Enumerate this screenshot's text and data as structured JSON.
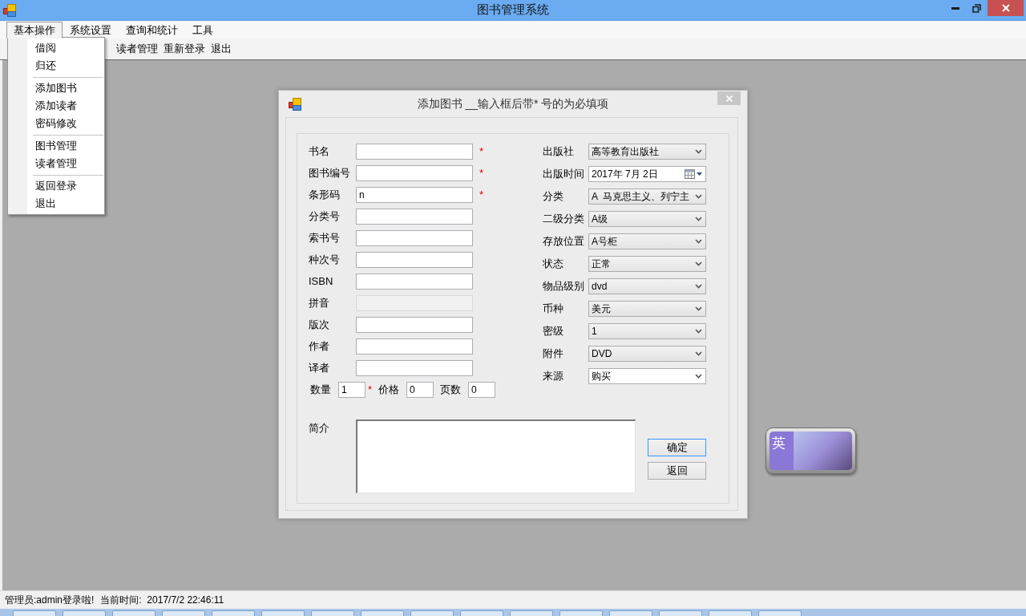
{
  "window": {
    "title": "图书管理系统"
  },
  "menubar": {
    "items": [
      {
        "label": "基本操作",
        "selected": true
      },
      {
        "label": "系统设置",
        "selected": false
      },
      {
        "label": "查询和统计",
        "selected": false
      },
      {
        "label": "工具",
        "selected": false
      }
    ]
  },
  "menu_dropdown": {
    "groups": [
      {
        "items": [
          "借阅",
          "归还"
        ]
      },
      {
        "items": [
          "添加图书",
          "添加读者",
          "密码修改"
        ]
      },
      {
        "items": [
          "图书管理",
          "读者管理"
        ]
      },
      {
        "items": [
          "返回登录",
          "退出"
        ]
      }
    ]
  },
  "toolbar": {
    "items": [
      "读者管理",
      "重新登录",
      "退出"
    ]
  },
  "dialog": {
    "title": "添加图书 __输入框后带* 号的为必填项",
    "left_fields": [
      {
        "label": "书名",
        "mark": "*",
        "disabled": false
      },
      {
        "label": "图书编号",
        "mark": "*",
        "disabled": false
      },
      {
        "label": "条形码",
        "value": "n",
        "mark": "*",
        "disabled": false
      },
      {
        "label": "分类号",
        "disabled": false
      },
      {
        "label": "索书号",
        "disabled": false
      },
      {
        "label": "种次号",
        "disabled": false
      },
      {
        "label": "ISBN",
        "disabled": false
      },
      {
        "label": "拼音",
        "disabled": true
      },
      {
        "label": "版次",
        "disabled": false
      },
      {
        "label": "作者",
        "disabled": false
      },
      {
        "label": "译者",
        "disabled": false
      }
    ],
    "count_row": [
      {
        "label": "数量",
        "value": "1",
        "mark": "*"
      },
      {
        "label": "价格",
        "value": "0"
      },
      {
        "label": "页数",
        "value": "0"
      }
    ],
    "right_fields": [
      {
        "label": "出版社",
        "kind": "select",
        "value": "高等教育出版社"
      },
      {
        "label": "出版时间",
        "kind": "date",
        "value": "2017年 7月 2日"
      },
      {
        "label": "分类",
        "kind": "select",
        "value": "A  马克思主义、列宁主"
      },
      {
        "label": "二级分类",
        "kind": "select",
        "value": "A级"
      },
      {
        "label": "存放位置",
        "kind": "select",
        "value": "A号柜"
      },
      {
        "label": "状态",
        "kind": "select",
        "value": "正常"
      },
      {
        "label": "物品级别",
        "kind": "select",
        "value": "dvd"
      },
      {
        "label": "币种",
        "kind": "select",
        "value": "美元"
      },
      {
        "label": "密级",
        "kind": "select",
        "value": "1"
      },
      {
        "label": "附件",
        "kind": "select",
        "value": "DVD"
      },
      {
        "label": "来源",
        "kind": "combo",
        "value": "购买"
      }
    ],
    "description": {
      "label": "简介"
    },
    "buttons": [
      {
        "label": "确定",
        "focused": true
      },
      {
        "label": "返回",
        "focused": false
      }
    ]
  },
  "ime_widget": {
    "label": "英"
  },
  "status_bar": {
    "items": [
      "管理员:admin登录啦!",
      "当前时间:  2017/7/2 22:46:11"
    ]
  }
}
